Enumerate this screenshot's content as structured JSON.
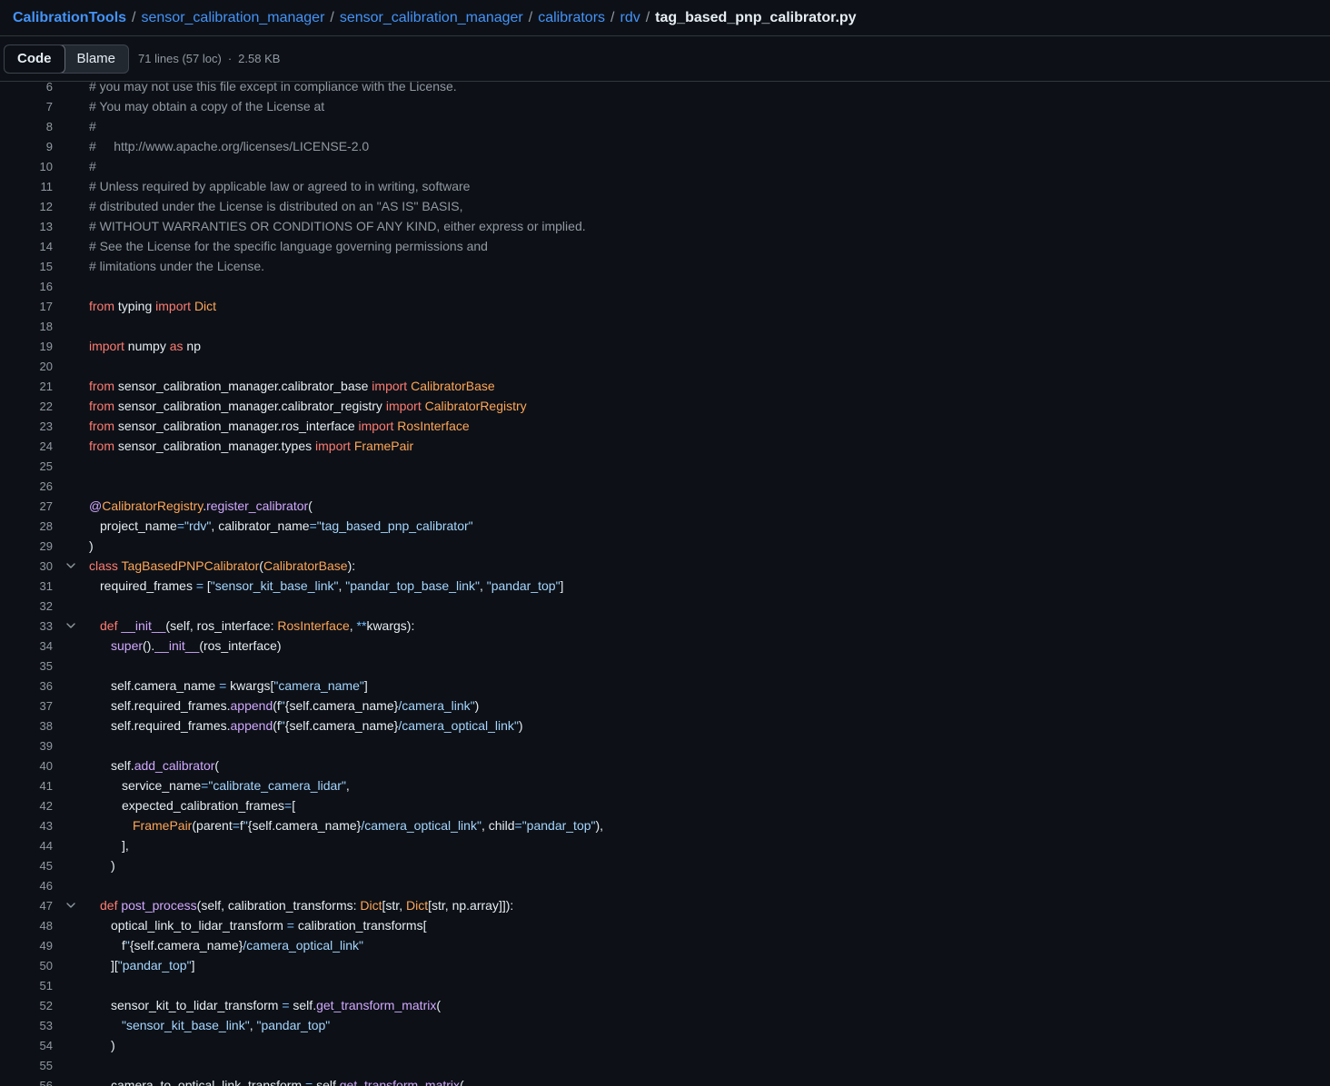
{
  "breadcrumb": {
    "repo": "CalibrationTools",
    "parts": [
      "sensor_calibration_manager",
      "sensor_calibration_manager",
      "calibrators",
      "rdv"
    ],
    "separator": "/",
    "file": "tag_based_pnp_calibrator.py"
  },
  "toolbar": {
    "code_label": "Code",
    "blame_label": "Blame",
    "lines_info": "71 lines (57 loc)",
    "dot": "·",
    "size_info": "2.58 KB"
  },
  "lines": [
    {
      "n": "6",
      "t": "# you may not use this file except in compliance with the License."
    },
    {
      "n": "7",
      "t": "# You may obtain a copy of the License at"
    },
    {
      "n": "8",
      "t": "#"
    },
    {
      "n": "9",
      "t": "#     http://www.apache.org/licenses/LICENSE-2.0"
    },
    {
      "n": "10",
      "t": "#"
    },
    {
      "n": "11",
      "t": "# Unless required by applicable law or agreed to in writing, software"
    },
    {
      "n": "12",
      "t": "# distributed under the License is distributed on an \"AS IS\" BASIS,"
    },
    {
      "n": "13",
      "t": "# WITHOUT WARRANTIES OR CONDITIONS OF ANY KIND, either express or implied."
    },
    {
      "n": "14",
      "t": "# See the License for the specific language governing permissions and"
    },
    {
      "n": "15",
      "t": "# limitations under the License."
    },
    {
      "n": "16",
      "t": ""
    },
    {
      "n": "17",
      "t": "from typing import Dict"
    },
    {
      "n": "18",
      "t": ""
    },
    {
      "n": "19",
      "t": "import numpy as np"
    },
    {
      "n": "20",
      "t": ""
    },
    {
      "n": "21",
      "t": "from sensor_calibration_manager.calibrator_base import CalibratorBase"
    },
    {
      "n": "22",
      "t": "from sensor_calibration_manager.calibrator_registry import CalibratorRegistry"
    },
    {
      "n": "23",
      "t": "from sensor_calibration_manager.ros_interface import RosInterface"
    },
    {
      "n": "24",
      "t": "from sensor_calibration_manager.types import FramePair"
    },
    {
      "n": "25",
      "t": ""
    },
    {
      "n": "26",
      "t": ""
    },
    {
      "n": "27",
      "t": "@CalibratorRegistry.register_calibrator("
    },
    {
      "n": "28",
      "t": "    project_name=\"rdv\", calibrator_name=\"tag_based_pnp_calibrator\""
    },
    {
      "n": "29",
      "t": ")"
    },
    {
      "n": "30",
      "t": "class TagBasedPNPCalibrator(CalibratorBase):"
    },
    {
      "n": "31",
      "t": "    required_frames = [\"sensor_kit_base_link\", \"pandar_top_base_link\", \"pandar_top\"]"
    },
    {
      "n": "32",
      "t": ""
    },
    {
      "n": "33",
      "t": "    def __init__(self, ros_interface: RosInterface, **kwargs):"
    },
    {
      "n": "34",
      "t": "        super().__init__(ros_interface)"
    },
    {
      "n": "35",
      "t": ""
    },
    {
      "n": "36",
      "t": "        self.camera_name = kwargs[\"camera_name\"]"
    },
    {
      "n": "37",
      "t": "        self.required_frames.append(f\"{self.camera_name}/camera_link\")"
    },
    {
      "n": "38",
      "t": "        self.required_frames.append(f\"{self.camera_name}/camera_optical_link\")"
    },
    {
      "n": "39",
      "t": ""
    },
    {
      "n": "40",
      "t": "        self.add_calibrator("
    },
    {
      "n": "41",
      "t": "            service_name=\"calibrate_camera_lidar\","
    },
    {
      "n": "42",
      "t": "            expected_calibration_frames=["
    },
    {
      "n": "43",
      "t": "                FramePair(parent=f\"{self.camera_name}/camera_optical_link\", child=\"pandar_top\"),"
    },
    {
      "n": "44",
      "t": "            ],"
    },
    {
      "n": "45",
      "t": "        )"
    },
    {
      "n": "46",
      "t": ""
    },
    {
      "n": "47",
      "t": "    def post_process(self, calibration_transforms: Dict[str, Dict[str, np.array]]):"
    },
    {
      "n": "48",
      "t": "        optical_link_to_lidar_transform = calibration_transforms["
    },
    {
      "n": "49",
      "t": "            f\"{self.camera_name}/camera_optical_link\""
    },
    {
      "n": "50",
      "t": "        ][\"pandar_top\"]"
    },
    {
      "n": "51",
      "t": ""
    },
    {
      "n": "52",
      "t": "        sensor_kit_to_lidar_transform = self.get_transform_matrix("
    },
    {
      "n": "53",
      "t": "            \"sensor_kit_base_link\", \"pandar_top\""
    },
    {
      "n": "54",
      "t": "        )"
    },
    {
      "n": "55",
      "t": ""
    },
    {
      "n": "56",
      "t": "        camera_to_optical_link_transform = self.get_transform_matrix("
    }
  ],
  "fold_lines": [
    "30",
    "33",
    "47"
  ],
  "colors": {
    "background": "#0d1117",
    "link": "#4493f8",
    "keyword": "#ff7b72",
    "class": "#ffa657",
    "function": "#d2a8ff",
    "string": "#a5d6ff",
    "comment": "#9198a1"
  },
  "icons": {
    "fold": "chevron-down-icon"
  }
}
